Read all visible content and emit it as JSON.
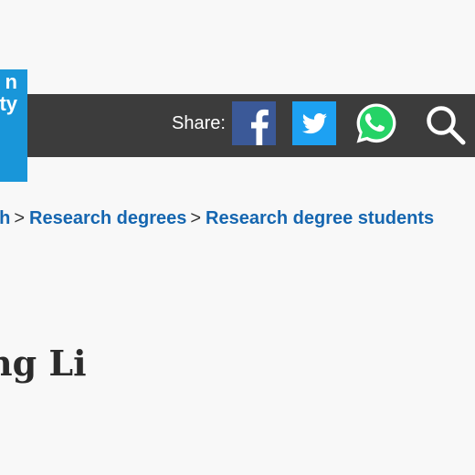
{
  "logo": {
    "lines": [
      "n",
      "ty"
    ],
    "color": "#1996d9"
  },
  "header": {
    "background": "#3c3c3c",
    "share_label": "Share:",
    "social": [
      {
        "name": "facebook",
        "icon": "facebook-icon",
        "color": "#3b5998"
      },
      {
        "name": "twitter",
        "icon": "twitter-icon",
        "color": "#1da1f2"
      },
      {
        "name": "whatsapp",
        "icon": "whatsapp-icon",
        "color": "#25d366"
      }
    ],
    "search_icon": "search-icon"
  },
  "breadcrumb": {
    "items": [
      "ch",
      "Research degrees",
      "Research degree students"
    ],
    "separator": ">",
    "link_color": "#1566b0"
  },
  "page": {
    "title": "ng Li"
  }
}
